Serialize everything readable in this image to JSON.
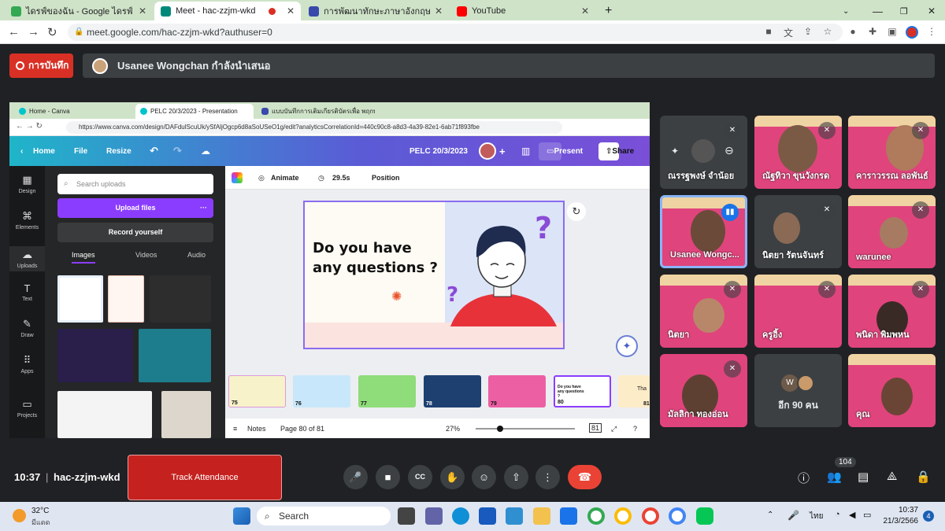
{
  "browser": {
    "tabs": [
      {
        "label": "ไดรฟ์ของฉัน - Google ไดรฟ์",
        "color": "#1a73e8"
      },
      {
        "label": "Meet - hac-zzjm-wkd",
        "color": "#00897b"
      },
      {
        "label": "การพัฒนาทักษะภาษาอังกฤษ English",
        "color": "#3949ab"
      },
      {
        "label": "YouTube",
        "color": "#ff0000"
      }
    ],
    "new_tab": "+",
    "url": "meet.google.com/hac-zzjm-wkd?authuser=0"
  },
  "meet": {
    "record_label": "การบันทึก",
    "presenter_text": "Usanee Wongchan กำลังนำเสนอ",
    "time": "10:37",
    "separator": "|",
    "meeting_code": "hac-zzjm-wkd",
    "track_attendance": "Track Attendance",
    "participant_count": "104",
    "more_people": "อีก 90 คน",
    "more_initial": "W"
  },
  "shared": {
    "tabs": [
      "Home - Canva",
      "PELC 20/3/2023 - Presentation",
      "แบบบันทึกการเติมเกียรติบัตรเพื่อ พฤกษ"
    ],
    "url": "https://www.canva.com/design/DAFdulScuUk/ySfAljOgcp6d8aSoUSeO1g/edit?analyticsCorrelationId=440c90c8-a8d3-4a39-82e1-6ab71f893fbe",
    "menu": {
      "home": "Home",
      "file": "File",
      "resize": "Resize"
    },
    "doc_title": "PELC 20/3/2023",
    "present": "Present",
    "share": "Share",
    "rail": [
      "Design",
      "Elements",
      "Uploads",
      "Text",
      "Draw",
      "Apps",
      "Projects"
    ],
    "search_placeholder": "Search uploads",
    "upload_files": "Upload files",
    "record_yourself": "Record yourself",
    "media_tabs": [
      "Images",
      "Videos",
      "Audio"
    ],
    "toolbar": {
      "animate": "Animate",
      "duration": "29.5s",
      "position": "Position"
    },
    "slide_text_1": "Do you have",
    "slide_text_2": "any questions ?",
    "film_numbers": [
      "75",
      "76",
      "77",
      "78",
      "79",
      "80",
      "81"
    ],
    "notes": "Notes",
    "page": "Page 80 of 81",
    "zoom": "27%",
    "pages_badge": "81",
    "film_80_text": "Do you have any questions ?",
    "film_81_text": "Tha"
  },
  "participants": [
    {
      "name": "ณรรฐพงษ์ จำน้อย"
    },
    {
      "name": "ณัฐทิวา ขุนวังกรด"
    },
    {
      "name": "คาราวรรณ ลอพันธ์"
    },
    {
      "name": "Usanee Wongc..."
    },
    {
      "name": "นิตยา รัตนจันทร์"
    },
    {
      "name": "warunee"
    },
    {
      "name": "นิตยา"
    },
    {
      "name": "ครูอิ้ง"
    },
    {
      "name": "พนิดา พิมพหน"
    },
    {
      "name": "มัลลิกา ทองอ่อน"
    },
    {
      "name": "คุณ"
    }
  ],
  "taskbar": {
    "temperature": "32°C",
    "weather": "มีแดด",
    "search": "Search",
    "lang": "ไทย",
    "time": "10:37",
    "date": "21/3/2566",
    "notif": "4"
  }
}
